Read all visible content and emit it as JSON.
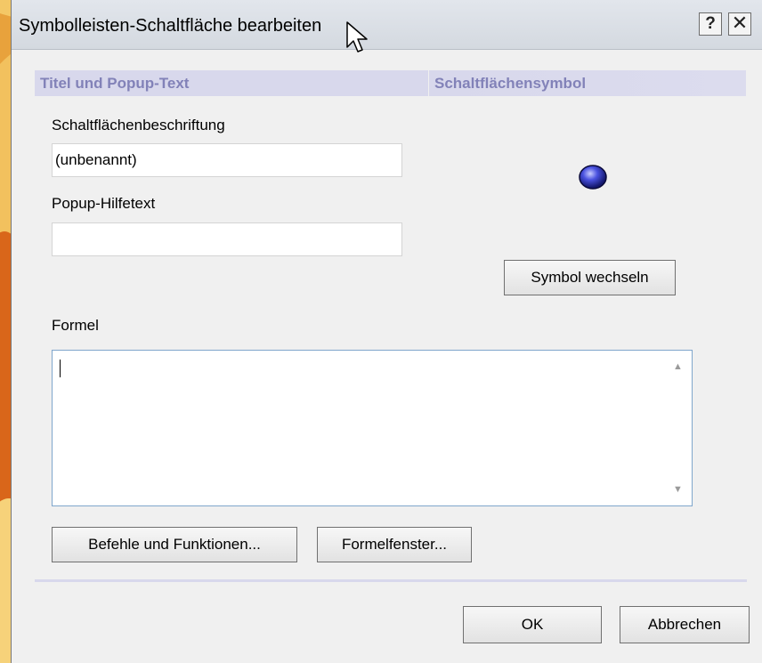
{
  "dialog": {
    "title": "Symbolleisten-Schaltfläche bearbeiten",
    "help_label": "?",
    "close_label": "✕"
  },
  "sections": {
    "title_popup": "Titel und Popup-Text",
    "button_symbol": "Schaltflächensymbol"
  },
  "fields": {
    "caption_label": "Schaltflächenbeschriftung",
    "caption_value": "(unbenannt)",
    "popup_label": "Popup-Hilfetext",
    "popup_value": "",
    "formula_label": "Formel",
    "formula_value": ""
  },
  "buttons": {
    "change_symbol": "Symbol wechseln",
    "commands_functions": "Befehle und Funktionen...",
    "formula_window": "Formelfenster...",
    "ok": "OK",
    "cancel": "Abbrechen"
  },
  "icons": {
    "symbol": "blue-sphere-icon",
    "cursor": "mouse-pointer-icon",
    "scroll_up": "scroll-up-arrow-icon",
    "scroll_down": "scroll-down-arrow-icon"
  },
  "colors": {
    "section_header_bg": "#d8d8ec",
    "section_header_text": "#8282b8",
    "textarea_border": "#7fa6cc"
  }
}
